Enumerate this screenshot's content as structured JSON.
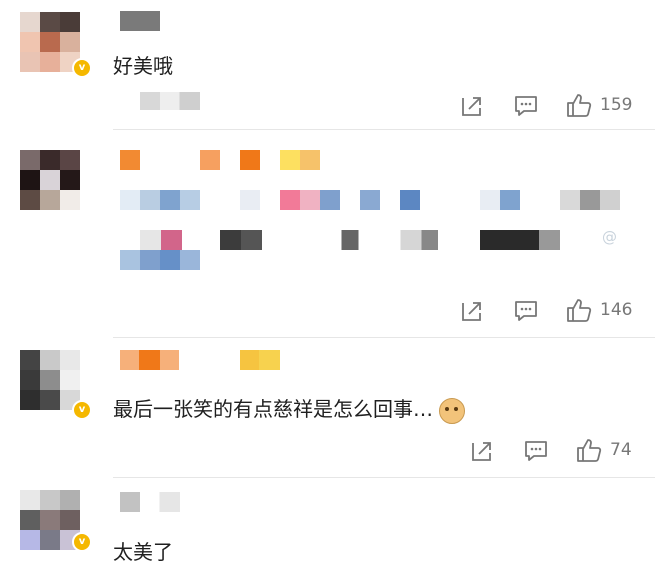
{
  "comments": [
    {
      "text": "好美哦",
      "like_count": "159"
    },
    {
      "text": "",
      "like_count": "146"
    },
    {
      "text": "最后一张笑的有点慈祥是怎么回事…",
      "like_count": "74",
      "emoji": "doge-emoji"
    },
    {
      "text": "太美了",
      "like_count": ""
    }
  ],
  "icons": {
    "share": "share-icon",
    "comment": "comment-icon",
    "like": "thumbs-up-icon",
    "verified": "verified-badge-icon"
  },
  "colors": {
    "badge": "#f5b800",
    "action_gray": "#777777",
    "divider": "#e6e6e6"
  }
}
